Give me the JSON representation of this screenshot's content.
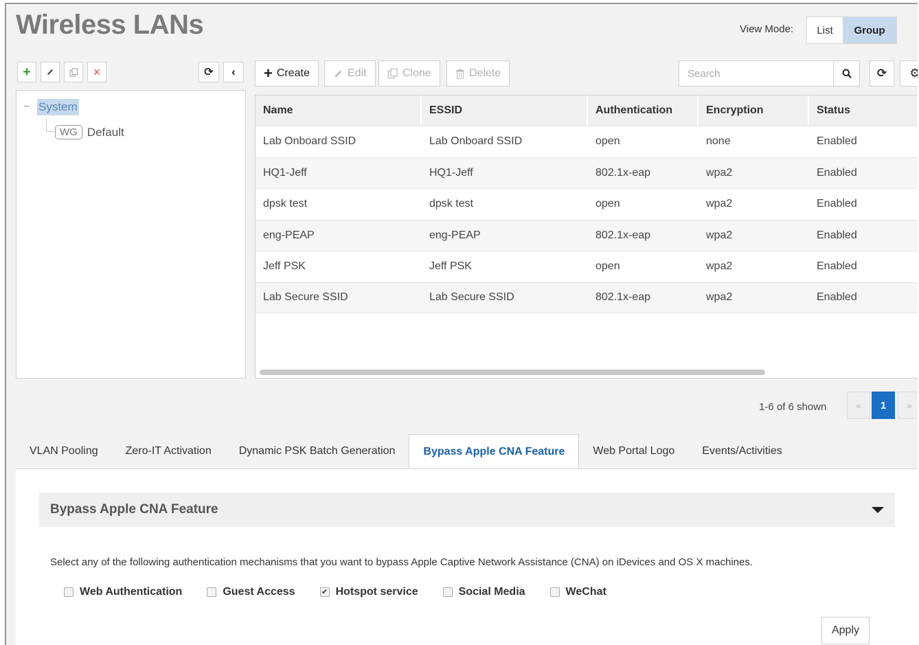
{
  "header": {
    "title": "Wireless LANs",
    "view_mode_label": "View Mode:",
    "view_mode_options": [
      "List",
      "Group"
    ],
    "view_mode_selected": "Group"
  },
  "tree_toolbar": {
    "icons": [
      "plus-icon",
      "pencil-icon",
      "copy-icon",
      "x-icon",
      "refresh-icon",
      "chevron-left-icon"
    ]
  },
  "tree": {
    "root_toggle": "−",
    "root_label": "System",
    "child_badge": "WG",
    "child_label": "Default"
  },
  "toolbar": {
    "create": "Create",
    "edit": "Edit",
    "clone": "Clone",
    "delete": "Delete",
    "search_placeholder": "Search"
  },
  "table": {
    "columns": [
      "Name",
      "ESSID",
      "Authentication",
      "Encryption",
      "Status"
    ],
    "rows": [
      [
        "Lab Onboard SSID",
        "Lab Onboard SSID",
        "open",
        "none",
        "Enabled"
      ],
      [
        "HQ1-Jeff",
        "HQ1-Jeff",
        "802.1x-eap",
        "wpa2",
        "Enabled"
      ],
      [
        "dpsk test",
        "dpsk test",
        "open",
        "wpa2",
        "Enabled"
      ],
      [
        "eng-PEAP",
        "eng-PEAP",
        "802.1x-eap",
        "wpa2",
        "Enabled"
      ],
      [
        "Jeff PSK",
        "Jeff PSK",
        "open",
        "wpa2",
        "Enabled"
      ],
      [
        "Lab Secure SSID",
        "Lab Secure SSID",
        "802.1x-eap",
        "wpa2",
        "Enabled"
      ]
    ]
  },
  "pager": {
    "summary": "1-6 of 6 shown",
    "prev": "«",
    "current": "1",
    "next": "»"
  },
  "tabs": [
    {
      "label": "VLAN Pooling",
      "active": false
    },
    {
      "label": "Zero-IT Activation",
      "active": false
    },
    {
      "label": "Dynamic PSK Batch Generation",
      "active": false
    },
    {
      "label": "Bypass Apple CNA Feature",
      "active": true
    },
    {
      "label": "Web Portal Logo",
      "active": false
    },
    {
      "label": "Events/Activities",
      "active": false
    }
  ],
  "section": {
    "title": "Bypass Apple CNA Feature",
    "description": "Select any of the following authentication mechanisms that you want to bypass Apple Captive Network Assistance (CNA) on iDevices and OS X machines.",
    "options": [
      {
        "label": "Web Authentication",
        "checked": false
      },
      {
        "label": "Guest Access",
        "checked": false
      },
      {
        "label": "Hotspot service",
        "checked": true
      },
      {
        "label": "Social Media",
        "checked": false
      },
      {
        "label": "WeChat",
        "checked": false
      }
    ],
    "apply": "Apply",
    "check_mark": "✔"
  },
  "colors": {
    "accent_blue": "#1a5fa8",
    "selection_blue": "#c6d9ec",
    "pager_active": "#1a6fc4",
    "add_green": "#3a9a3a",
    "delete_red": "#d9534f"
  }
}
